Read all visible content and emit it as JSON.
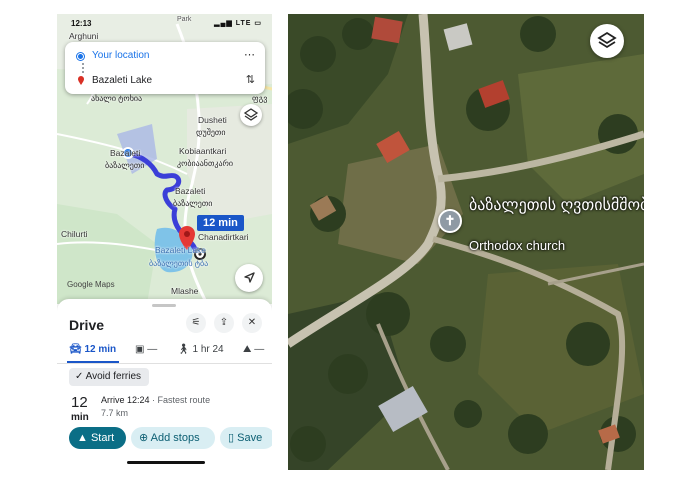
{
  "phone": {
    "status": {
      "time": "12:13",
      "network": "LTE"
    },
    "search": {
      "origin": "Your location",
      "destination": "Bazaleti Lake"
    },
    "map_labels": {
      "park": "Park",
      "arghuni": "Arghuni",
      "arghuni_geo": "ახალი ტოხია",
      "corner_geo": "ფგვ",
      "dusheti": "Dusheti",
      "dusheti_geo": "დუშეთი",
      "kobiaantkari": "Kobiaantkari",
      "kobiaantkari_geo": "კობიაანთკარი",
      "bazaleti1": "Bazaleti",
      "bazaleti1_geo": "ბაზალეთი",
      "bazaleti2": "Bazaleti",
      "bazaleti2_geo": "ბაზალეთი",
      "chilurti": "Chilurti",
      "chanadirtkari": "Chanadirtkari",
      "lake": "Bazaleti Lake",
      "lake_geo": "ბაზალეთის ტბა",
      "mlashe": "Mlashe",
      "google": "Google Maps"
    },
    "eta_badge": "12 min",
    "sheet": {
      "title": "Drive",
      "modes": [
        {
          "icon": "car-icon",
          "label": "12 min"
        },
        {
          "icon": "transit-icon",
          "label": "—"
        },
        {
          "icon": "walk-icon",
          "label": "1 hr 24"
        },
        {
          "icon": "hike-icon",
          "label": "—"
        }
      ],
      "chip": "Avoid ferries",
      "duration_num": "12",
      "duration_unit": "min",
      "arrive": "Arrive 12:24",
      "route_note": "· Fastest route",
      "distance": "7.7 km",
      "buttons": {
        "start": "Start",
        "add_stops": "Add stops",
        "save": "Save"
      }
    }
  },
  "satellite": {
    "place_name": "ბაზალეთის ღვთისმშობლის...",
    "place_type": "Orthodox church"
  },
  "colors": {
    "route": "#3b3fd8",
    "accent": "#1a56c8",
    "start_button": "#0b6e86",
    "pin": "#e53935"
  }
}
